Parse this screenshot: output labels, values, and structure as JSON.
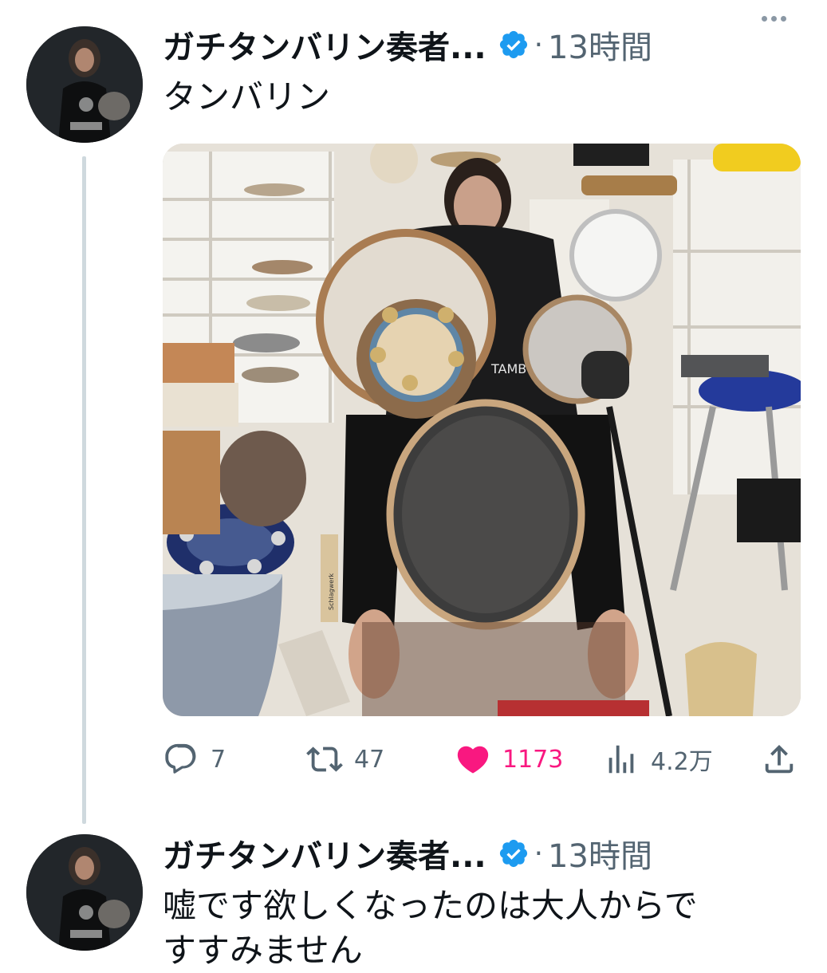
{
  "tweets": [
    {
      "author_name": "ガチタンバリン奏者...",
      "separator": "·",
      "time": "13時間",
      "text": "タンバリン",
      "media": {
        "shirt_text": "TAMBOURINE",
        "stand_text": "Schlagwerk"
      },
      "actions": {
        "reply": {
          "icon": "reply-icon",
          "count": "7"
        },
        "retweet": {
          "icon": "retweet-icon",
          "count": "47"
        },
        "like": {
          "icon": "heart-icon",
          "count": "1173",
          "liked": true
        },
        "views": {
          "icon": "bar-chart-icon",
          "count": "4.2万"
        },
        "share": {
          "icon": "share-icon"
        }
      }
    },
    {
      "author_name": "ガチタンバリン奏者...",
      "separator": "·",
      "time": "13時間",
      "text": "嘘です欲しくなったのは大人からで\nすすみません"
    }
  ],
  "colors": {
    "verified": "#1d9bf0",
    "like": "#f91880",
    "secondary_text": "#536471",
    "thread_line": "#cfd9de"
  }
}
